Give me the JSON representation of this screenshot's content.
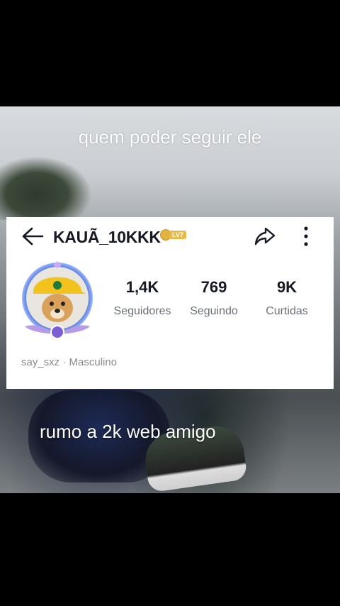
{
  "captions": {
    "top": "quem poder seguir ele",
    "bottom": "rumo a 2k web amigo"
  },
  "profile": {
    "username": "KAUÃ_10KKK",
    "level_badge": "LV7",
    "stats": [
      {
        "value": "1,4K",
        "label": "Seguidores"
      },
      {
        "value": "769",
        "label": "Seguindo"
      },
      {
        "value": "9K",
        "label": "Curtidas"
      }
    ],
    "handle": "say_sxz",
    "separator": "·",
    "gender": "Masculino"
  },
  "icons": {
    "back": "arrow-left-icon",
    "share": "share-arrow-icon",
    "more": "vertical-ellipsis-icon"
  },
  "colors": {
    "text_primary": "#161823",
    "text_secondary": "#6e7079",
    "badge_gold": "#e7b84a"
  }
}
